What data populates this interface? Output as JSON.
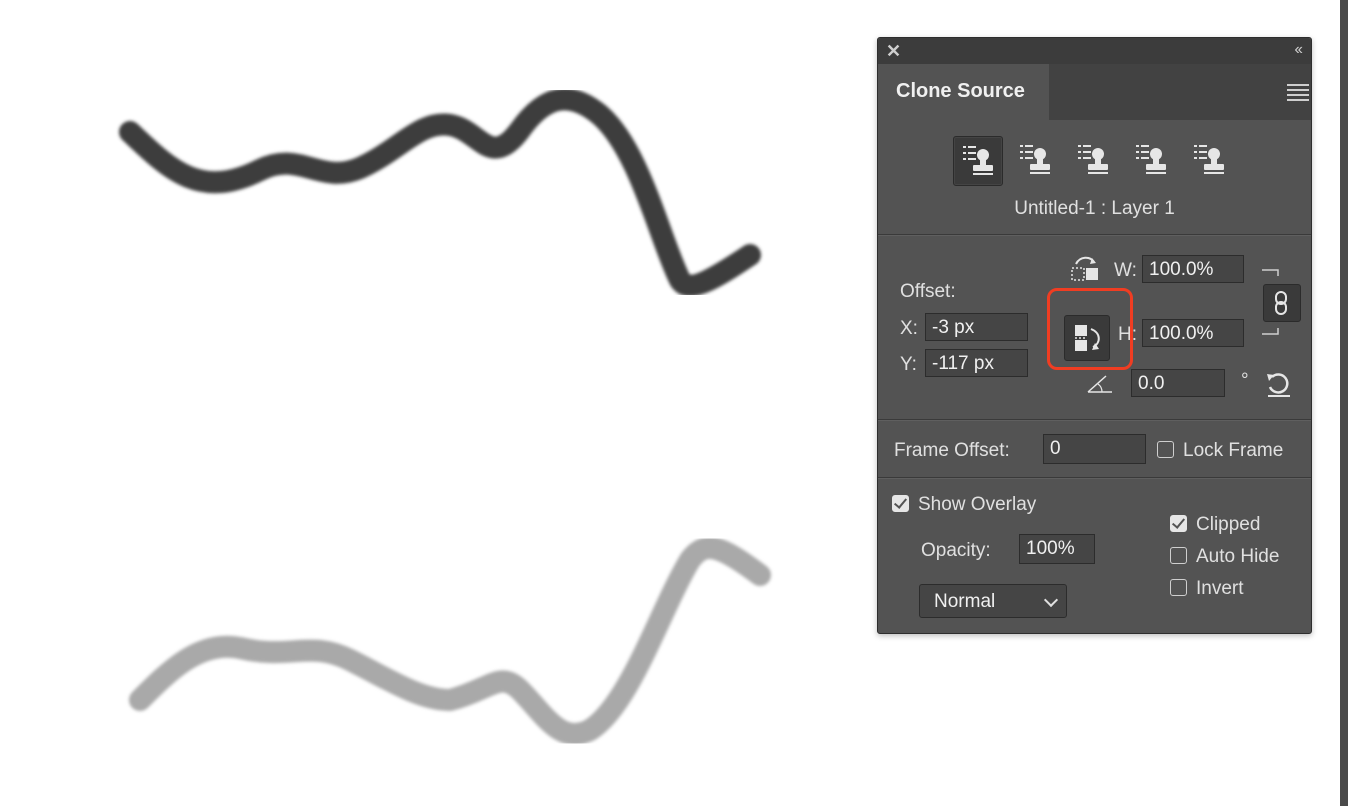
{
  "canvas": {
    "stroke_top_color": "#3a3a3a",
    "stroke_bottom_color": "#a8a8a8"
  },
  "panel": {
    "title": "Clone Source",
    "layer_name": "Untitled-1 : Layer 1",
    "close_icon": "close-icon",
    "collapse_icon": "collapse-icon",
    "offset_label": "Offset:",
    "x_label": "X:",
    "x_value": "-3 px",
    "y_label": "Y:",
    "y_value": "-117 px",
    "w_label": "W:",
    "w_value": "100.0%",
    "h_label": "H:",
    "h_value": "100.0%",
    "angle_value": "0.0",
    "degree_symbol": "°",
    "frame_offset_label": "Frame Offset:",
    "frame_offset_value": "0",
    "lock_frame_label": "Lock Frame",
    "lock_frame_checked": false,
    "show_overlay_label": "Show Overlay",
    "show_overlay_checked": true,
    "opacity_label": "Opacity:",
    "opacity_value": "100%",
    "blend_mode": "Normal",
    "clipped_label": "Clipped",
    "clipped_checked": true,
    "auto_hide_label": "Auto Hide",
    "auto_hide_checked": false,
    "invert_label": "Invert",
    "invert_checked": false,
    "highlight_color": "#f03d22"
  }
}
